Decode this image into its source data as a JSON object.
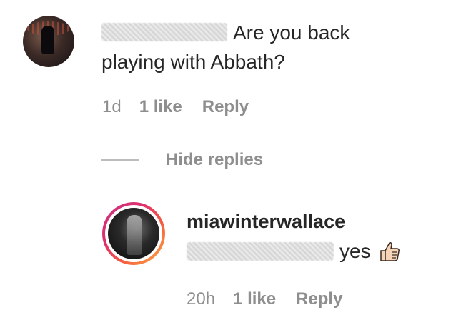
{
  "comment": {
    "text_line1": "Are you back",
    "text_line2": "playing with Abbath?",
    "time": "1d",
    "likes": "1 like",
    "reply_label": "Reply"
  },
  "hide_replies": {
    "label": "Hide replies"
  },
  "reply": {
    "username": "miawinterwallace",
    "text": "yes",
    "emoji": "thumbs-up-icon",
    "time": "20h",
    "likes": "1 like",
    "reply_label": "Reply"
  },
  "colors": {
    "text": "#262626",
    "secondary": "#8e8e8e",
    "ring_start": "#c13584",
    "ring_end": "#fcaf45"
  }
}
